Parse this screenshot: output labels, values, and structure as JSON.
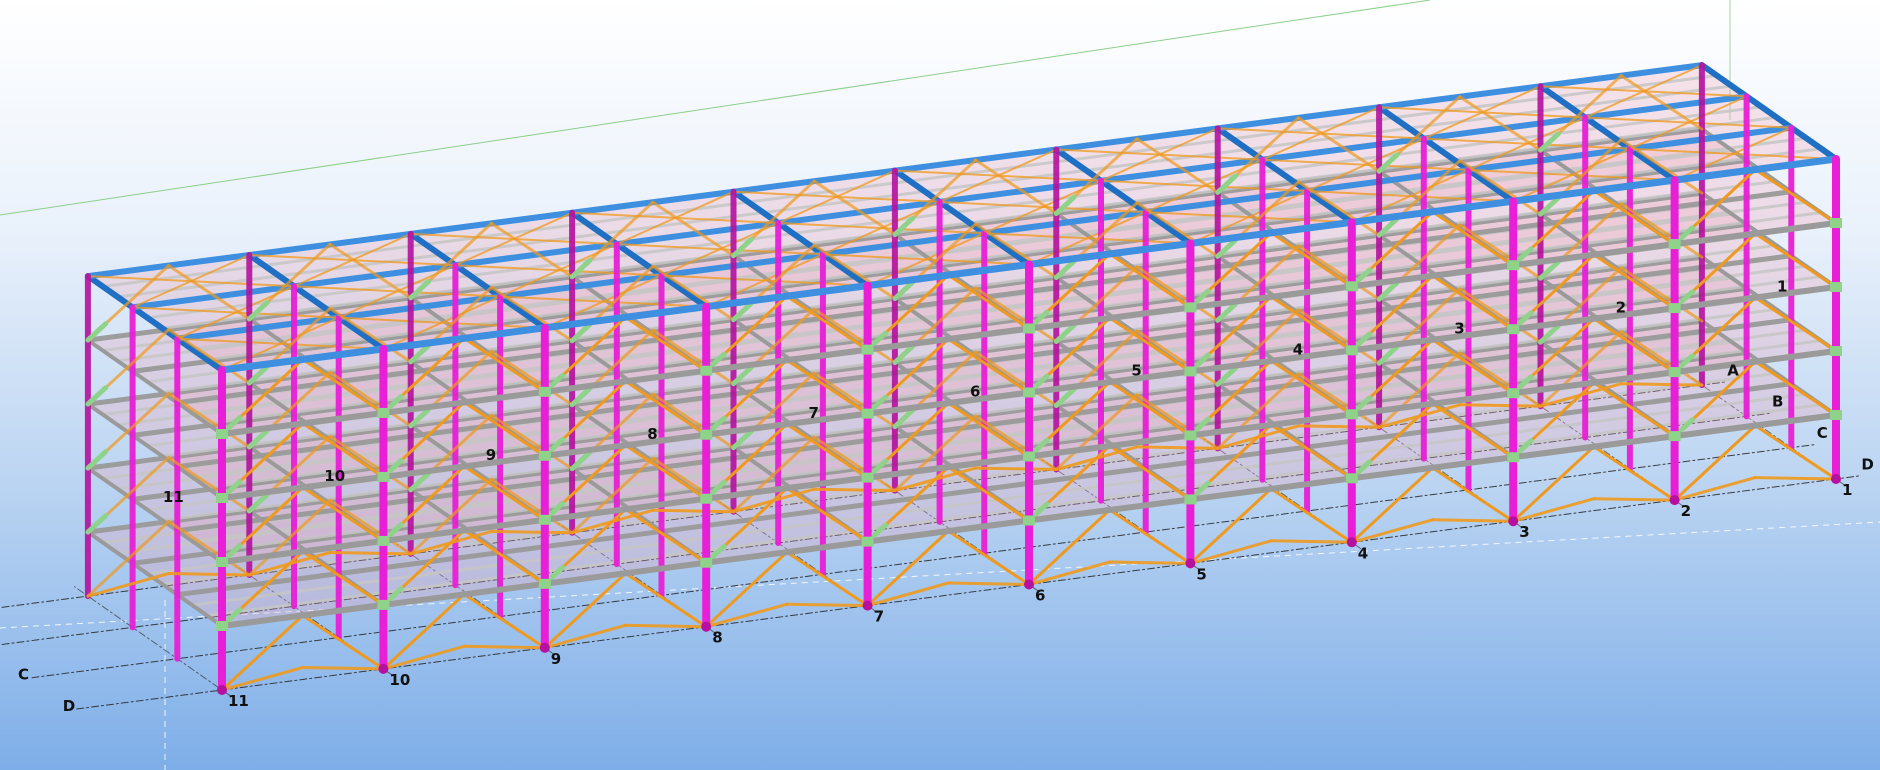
{
  "view": {
    "name": "structural 3D model",
    "projection": "isometric"
  },
  "colors": {
    "column": "#e81fd6",
    "column_dark": "#b5109f",
    "brace": "#ef9a1e",
    "beam": "#9a9a9a",
    "beam_light": "#c6c6c6",
    "roof_beam": "#3f8fe0",
    "roof_beam_dark": "#1f6fc4",
    "floor_fill": "#f2a0b4",
    "connection": "#8fd28a",
    "grid": "#222222",
    "guide": "#8ccf8a"
  },
  "grid_lines": {
    "numbered": [
      "1",
      "2",
      "3",
      "4",
      "5",
      "6",
      "7",
      "8",
      "9",
      "10",
      "11"
    ],
    "lettered": [
      "A",
      "B",
      "C",
      "D"
    ]
  },
  "structure": {
    "bays": 10,
    "stories": 5
  }
}
